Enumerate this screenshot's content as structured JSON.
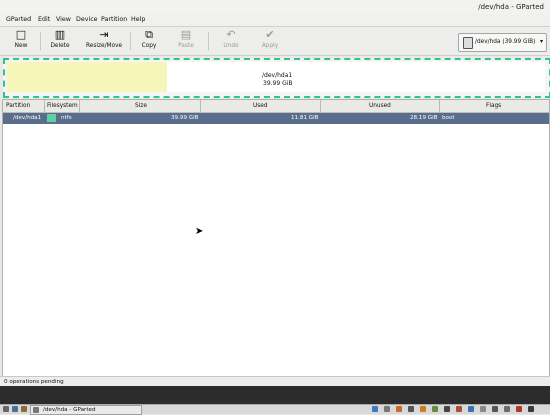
{
  "window": {
    "title": "/dev/hda - GParted"
  },
  "menu": [
    "GParted",
    "Edit",
    "View",
    "Device",
    "Partition",
    "Help"
  ],
  "toolbar": {
    "new": "New",
    "delete": "Delete",
    "resize": "Resize/Move",
    "copy": "Copy",
    "paste": "Paste",
    "undo": "Undo",
    "apply": "Apply"
  },
  "device_selector": {
    "value": "/dev/hda (39.99 GiB)"
  },
  "disk_graphic": {
    "partition": "/dev/hda1",
    "size": "39.99 GiB"
  },
  "table": {
    "headers": [
      "Partition",
      "Filesystem",
      "Size",
      "Used",
      "Unused",
      "Flags"
    ],
    "rows": [
      {
        "partition": "/dev/hda1",
        "filesystem": "ntfs",
        "size": "39.99 GiB",
        "used": "11.81 GiB",
        "unused": "28.19 GiB",
        "flags": "boot"
      }
    ]
  },
  "status": "0 operations pending",
  "taskbar": {
    "task": "/dev/hda - GParted"
  },
  "colors": {
    "fs_ntfs": "#5fd0a2",
    "selection": "#5a6d8c",
    "used_fill": "#f6f6b8",
    "border_dash": "#2ec58a"
  }
}
